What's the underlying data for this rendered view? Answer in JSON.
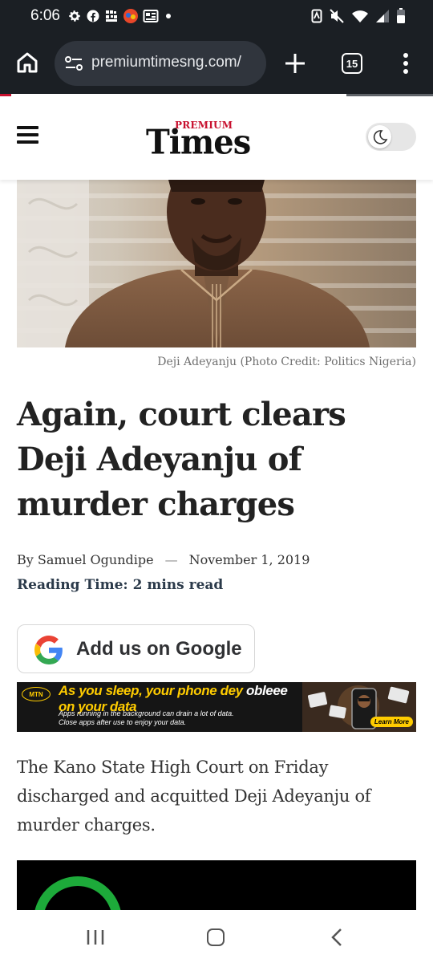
{
  "status_bar": {
    "time": "6:06",
    "left_icons": [
      "gear-icon",
      "facebook-icon",
      "grid-app-icon",
      "app-avatar-icon",
      "news-icon",
      "dot-icon"
    ],
    "right_icons": [
      "nfc-icon",
      "mute-icon",
      "wifi-icon",
      "signal-icon",
      "battery-icon"
    ]
  },
  "browser": {
    "url": "premiumtimesng.com/",
    "tab_count": "15"
  },
  "site": {
    "logo_small": "PREMIUM",
    "logo_big": "Times"
  },
  "article": {
    "photo_caption": "Deji Adeyanju (Photo Credit: Politics Nigeria)",
    "headline": "Again, court clears Deji Adeyanju of murder charges",
    "author": "By Samuel Ogundipe",
    "byline_separator": "—",
    "date": "November 1, 2019",
    "reading_time_label": "Reading Time:",
    "reading_time_value": "2 mins read",
    "paragraph_1": "The Kano State High Court on Friday discharged and acquitted Deji Adeyanju of murder charges."
  },
  "google_button": {
    "label": "Add us on Google"
  },
  "ad": {
    "brand": "MTN",
    "headline_part1": "As you sleep, your phone dey ",
    "headline_part2": "obleee",
    "headline_line2": "on your data",
    "sub_line1": "Apps running in the background can drain a lot of data.",
    "sub_line2": "Close apps after use to enjoy your data.",
    "cta": "Learn More"
  },
  "colors": {
    "brand_red": "#c8102e",
    "mtn_yellow": "#ffcc00",
    "chrome_dark": "#1b1f24",
    "headline_text": "#222222"
  }
}
